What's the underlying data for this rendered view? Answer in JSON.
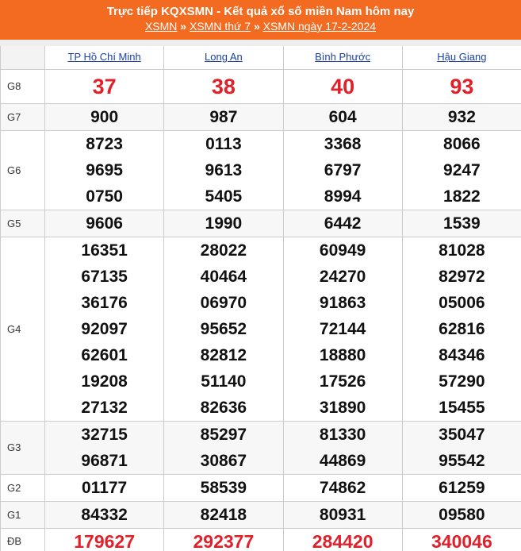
{
  "header": {
    "title": "Trực tiếp KQXSMN - Kết quả xổ số miền Nam hôm nay",
    "crumbs": [
      "XSMN",
      "XSMN thứ 7",
      "XSMN ngày 17-2-2024"
    ],
    "separator": "»"
  },
  "provinces": [
    "TP Hồ Chí Minh",
    "Long An",
    "Bình Phước",
    "Hậu Giang"
  ],
  "prizes": [
    {
      "label": "G8",
      "values": [
        [
          "37"
        ],
        [
          "38"
        ],
        [
          "40"
        ],
        [
          "93"
        ]
      ]
    },
    {
      "label": "G7",
      "values": [
        [
          "900"
        ],
        [
          "987"
        ],
        [
          "604"
        ],
        [
          "932"
        ]
      ]
    },
    {
      "label": "G6",
      "values": [
        [
          "8723",
          "9695",
          "0750"
        ],
        [
          "0113",
          "9613",
          "5405"
        ],
        [
          "3368",
          "6797",
          "8994"
        ],
        [
          "8066",
          "9247",
          "1822"
        ]
      ]
    },
    {
      "label": "G5",
      "values": [
        [
          "9606"
        ],
        [
          "1990"
        ],
        [
          "6442"
        ],
        [
          "1539"
        ]
      ]
    },
    {
      "label": "G4",
      "values": [
        [
          "16351",
          "67135",
          "36176",
          "92097",
          "62601",
          "19208",
          "27132"
        ],
        [
          "28022",
          "40464",
          "06970",
          "95652",
          "82812",
          "51140",
          "82636"
        ],
        [
          "60949",
          "24270",
          "91863",
          "72144",
          "18880",
          "17526",
          "31890"
        ],
        [
          "81028",
          "82972",
          "05006",
          "62816",
          "84346",
          "57290",
          "15455"
        ]
      ]
    },
    {
      "label": "G3",
      "values": [
        [
          "32715",
          "96871"
        ],
        [
          "85297",
          "30867"
        ],
        [
          "81330",
          "44869"
        ],
        [
          "35047",
          "95542"
        ]
      ]
    },
    {
      "label": "G2",
      "values": [
        [
          "01177"
        ],
        [
          "58539"
        ],
        [
          "74862"
        ],
        [
          "61259"
        ]
      ]
    },
    {
      "label": "G1",
      "values": [
        [
          "84332"
        ],
        [
          "82418"
        ],
        [
          "80931"
        ],
        [
          "09580"
        ]
      ]
    },
    {
      "label": "ĐB",
      "values": [
        [
          "179627"
        ],
        [
          "292377"
        ],
        [
          "284420"
        ],
        [
          "340046"
        ]
      ]
    }
  ]
}
